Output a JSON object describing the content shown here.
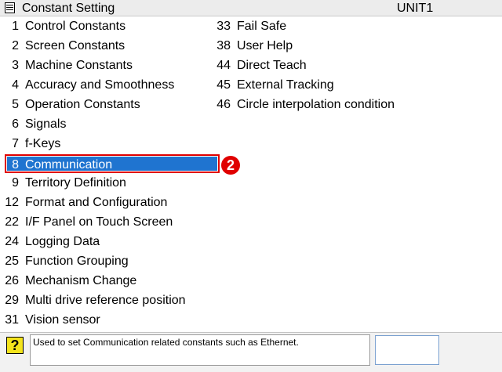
{
  "window": {
    "title": "Constant Setting",
    "unit": "UNIT1"
  },
  "menu_left": [
    {
      "num": "1",
      "label": "Control Constants"
    },
    {
      "num": "2",
      "label": "Screen Constants"
    },
    {
      "num": "3",
      "label": "Machine Constants"
    },
    {
      "num": "4",
      "label": "Accuracy and Smoothness"
    },
    {
      "num": "5",
      "label": "Operation Constants"
    },
    {
      "num": "6",
      "label": "Signals"
    },
    {
      "num": "7",
      "label": "f-Keys"
    },
    {
      "num": "8",
      "label": "Communication",
      "selected": true
    },
    {
      "num": "9",
      "label": "Territory Definition"
    },
    {
      "num": "12",
      "label": "Format and Configuration"
    },
    {
      "num": "22",
      "label": "I/F Panel on Touch Screen"
    },
    {
      "num": "24",
      "label": "Logging Data"
    },
    {
      "num": "25",
      "label": "Function Grouping"
    },
    {
      "num": "26",
      "label": "Mechanism Change"
    },
    {
      "num": "29",
      "label": "Multi drive reference position"
    },
    {
      "num": "31",
      "label": "Vision sensor"
    }
  ],
  "menu_right": [
    {
      "num": "33",
      "label": "Fail Safe"
    },
    {
      "num": "38",
      "label": "User Help"
    },
    {
      "num": "44",
      "label": "Direct Teach"
    },
    {
      "num": "45",
      "label": "External Tracking"
    },
    {
      "num": "46",
      "label": "Circle interpolation condition"
    }
  ],
  "annotation": {
    "step_number": "2"
  },
  "status": {
    "help_icon": "?",
    "message": "Used to set Communication related constants such as Ethernet."
  },
  "colors": {
    "selection": "#1f74d0",
    "highlight_border": "#e00000",
    "help_icon": "#f4e41c"
  }
}
